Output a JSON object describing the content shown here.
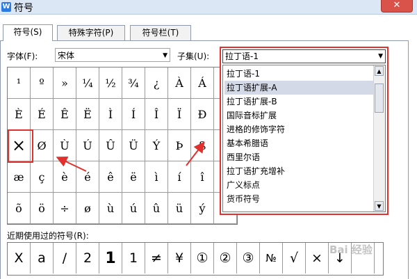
{
  "window": {
    "title": "符号",
    "close_glyph": "✕"
  },
  "tabs": [
    {
      "label": "符号(S)",
      "active": true
    },
    {
      "label": "特殊字符(P)",
      "active": false
    },
    {
      "label": "符号栏(T)",
      "active": false
    }
  ],
  "font": {
    "label": "字体(F):",
    "value": "宋体"
  },
  "subset": {
    "label": "子集(U):",
    "value": "拉丁语-1",
    "options": [
      "拉丁语-1",
      "拉丁语扩展-A",
      "拉丁语扩展-B",
      "国际音标扩展",
      "进格的修饰字符",
      "基本希腊语",
      "西里尔语",
      "拉丁语扩充增补",
      "广义标点",
      "货币符号"
    ],
    "selected_index": 1
  },
  "symbols": [
    [
      "¹",
      "º",
      "»",
      "¼",
      "½",
      "¾",
      "¿",
      "À",
      "Á",
      ""
    ],
    [
      "È",
      "É",
      "Ê",
      "Ë",
      "Ì",
      "Í",
      "Î",
      "Ï",
      "Ð",
      ""
    ],
    [
      "×",
      "Ø",
      "Ù",
      "Ú",
      "Û",
      "Ü",
      "Ý",
      "Þ",
      "ß",
      ""
    ],
    [
      "æ",
      "ç",
      "è",
      "é",
      "ê",
      "ë",
      "ì",
      "í",
      "î",
      ""
    ],
    [
      "õ",
      "ö",
      "÷",
      "ø",
      "ù",
      "ú",
      "û",
      "ü",
      "ý",
      ""
    ]
  ],
  "recent": {
    "label": "近期使用过的符号(R):",
    "symbols": [
      "X",
      "a",
      "/",
      "2",
      "1",
      "1",
      "≠",
      "¥",
      "①",
      "②",
      "③",
      "№",
      "√",
      "×",
      "↓",
      "",
      ""
    ]
  },
  "watermark": "Bai 经验",
  "colors": {
    "highlight": "#e0312e",
    "accent": "#2d7be0",
    "selected_bg": "#d4d9e7"
  }
}
